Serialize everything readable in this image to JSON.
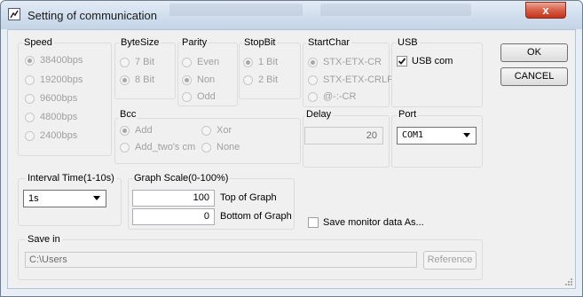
{
  "window": {
    "title": "Setting of communication",
    "close_label": "x"
  },
  "speed": {
    "label": "Speed",
    "options": [
      "38400bps",
      "19200bps",
      "9600bps",
      "4800bps",
      "2400bps"
    ]
  },
  "bytesize": {
    "label": "ByteSize",
    "options": [
      "7 Bit",
      "8 Bit"
    ]
  },
  "parity": {
    "label": "Parity",
    "options": [
      "Even",
      "Non",
      "Odd"
    ]
  },
  "stopbit": {
    "label": "StopBit",
    "options": [
      "1 Bit",
      "2 Bit"
    ]
  },
  "startchar": {
    "label": "StartChar",
    "options": [
      "STX-ETX-CR",
      "STX-ETX-CRLF",
      "@-:-CR"
    ]
  },
  "usb": {
    "label": "USB",
    "checkbox_label": "USB com",
    "checked": true
  },
  "buttons": {
    "ok": "OK",
    "cancel": "CANCEL",
    "reference": "Reference"
  },
  "bcc": {
    "label": "Bcc",
    "options": [
      "Add",
      "Xor",
      "Add_two's cm",
      "None"
    ]
  },
  "delay": {
    "label": "Delay",
    "value": "20"
  },
  "port": {
    "label": "Port",
    "value": "COM1"
  },
  "interval": {
    "label": "Interval Time(1-10s)",
    "value": "1s"
  },
  "graph": {
    "label": "Graph Scale(0-100%)",
    "top_value": "100",
    "top_label": "Top of Graph",
    "bottom_value": "0",
    "bottom_label": "Bottom of Graph"
  },
  "save_monitor": {
    "label": "Save monitor data As...",
    "checked": false
  },
  "save_in": {
    "label": "Save in",
    "value": "C:\\Users"
  }
}
